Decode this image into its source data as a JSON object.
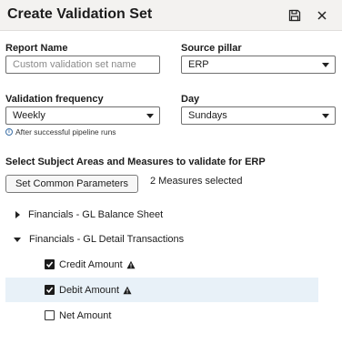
{
  "dialog": {
    "title": "Create Validation Set"
  },
  "form": {
    "report_name": {
      "label": "Report Name",
      "placeholder": "Custom validation set name",
      "value": ""
    },
    "source_pillar": {
      "label": "Source pillar",
      "value": "ERP"
    },
    "frequency": {
      "label": "Validation frequency",
      "value": "Weekly",
      "hint": "After successful pipeline runs"
    },
    "day": {
      "label": "Day",
      "value": "Sundays"
    }
  },
  "selection": {
    "heading": "Select Subject Areas and Measures to validate for ERP",
    "common_button": "Set Common Parameters",
    "count": "2 Measures selected"
  },
  "tree": {
    "areas": [
      {
        "label": "Financials - GL Balance Sheet",
        "expanded": false
      },
      {
        "label": "Financials - GL Detail Transactions",
        "expanded": true
      }
    ],
    "measures": [
      {
        "label": "Credit Amount",
        "checked": true,
        "warning": true
      },
      {
        "label": "Debit Amount",
        "checked": true,
        "warning": true
      },
      {
        "label": "Net Amount",
        "checked": false,
        "warning": false
      }
    ]
  }
}
